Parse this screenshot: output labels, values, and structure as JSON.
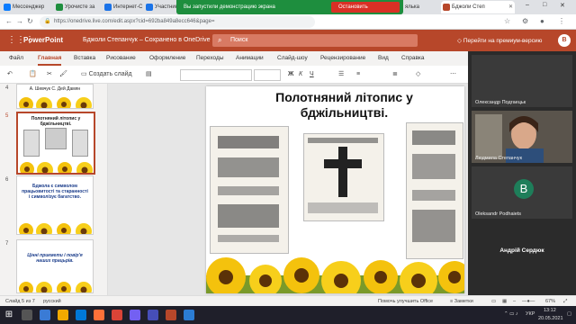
{
  "browser": {
    "tabs": [
      {
        "label": "Мессенджер",
        "color": "#0a7cff"
      },
      {
        "label": "Урочисте за",
        "color": "#1e8e3e"
      },
      {
        "label": "Интернет-С",
        "color": "#1a73e8"
      },
      {
        "label": "Участник",
        "color": "#1a73e8"
      },
      {
        "label": "ялька",
        "color": "#888888"
      },
      {
        "label": "Бджоли Степ",
        "color": "#b7472a"
      }
    ],
    "share_banner": "Вы запустили демонстрацию экрана",
    "stop_button": "Остановить демонстрацию",
    "url": "https://onedrive.live.com/edit.aspx?cid=692ba849a8ecc646&page=",
    "window_controls": [
      "–",
      "□",
      "✕"
    ]
  },
  "office": {
    "app_name": "PowerPoint",
    "doc_title": "Бджоли Степанчук – Сохранено в OneDrive",
    "search_placeholder": "Поиск",
    "premium_text": "Перейти на премиум-версию",
    "avatar_initial": "B",
    "accent": "#b7472a"
  },
  "menu": [
    "Файл",
    "Главная",
    "Вставка",
    "Рисование",
    "Оформление",
    "Переходы",
    "Анимации",
    "Слайд-шоу",
    "Рецензирование",
    "Вид",
    "Справка"
  ],
  "ribbon": {
    "create_slide": "Создать слайд",
    "bold": "Ж",
    "italic": "К",
    "underline": "Ч",
    "right_label": "Приве"
  },
  "thumbnails": [
    {
      "num": "4",
      "text": "А. Шевчук С. Дей Дамян"
    },
    {
      "num": "5",
      "text": "Полотняний літопис у бджільництві."
    },
    {
      "num": "6",
      "text": "Бджола є символом працьовитості та старанності і символізує багатство."
    },
    {
      "num": "7",
      "text": "Цінні прикмети і повір'я наших працьрів."
    }
  ],
  "slide": {
    "title": "Полотняний літопис у бджільництві."
  },
  "teams": {
    "participants": [
      {
        "name": "Олександр Подгаецьк"
      },
      {
        "name": "Людмила Степанчук"
      },
      {
        "name": "Oleksandr Podhaiets",
        "initial": "B"
      }
    ],
    "speaker": "Андрій Сердюк"
  },
  "status": {
    "slide_info": "Слайд 5 из 7",
    "language": "русский",
    "feedback": "Помочь улучшить Office",
    "notes": "Заметки",
    "zoom": "67%"
  },
  "taskbar": {
    "lang": "УКР",
    "time": "13:12",
    "date": "20.05.2021"
  }
}
